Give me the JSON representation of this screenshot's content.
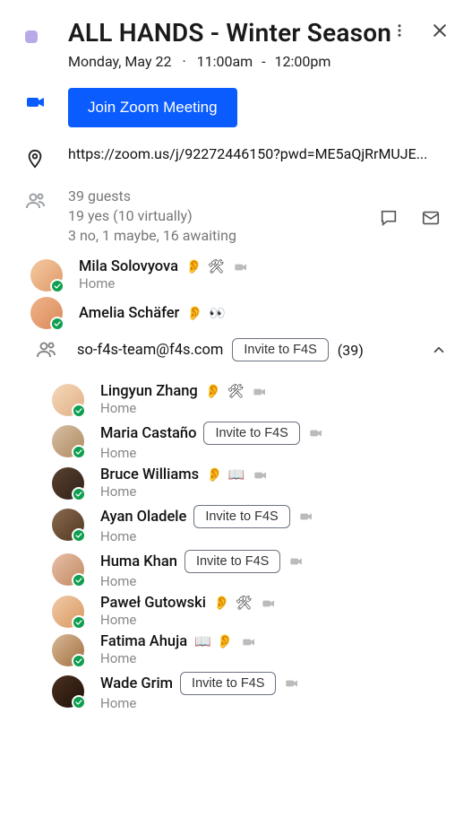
{
  "header": {
    "title": "ALL HANDS - Winter Season",
    "date": "Monday, May 22",
    "time_start": "11:00am",
    "time_end": "12:00pm",
    "color": "#b9a9e8"
  },
  "join": {
    "label": "Join Zoom Meeting",
    "link": "https://zoom.us/j/92272446150?pwd=ME5aQjRrMUJE..."
  },
  "guests": {
    "total_line": "39 guests",
    "yes_line": "19 yes (10 virtually)",
    "status_line": "3 no, 1 maybe, 16 awaiting"
  },
  "invite_label": "Invite to F4S",
  "attendees_top": [
    {
      "name": "Mila Solovyova",
      "sub": "Home",
      "badges": [
        "👂",
        "🛠"
      ],
      "video": true
    },
    {
      "name": "Amelia Schäfer",
      "sub": "",
      "badges": [
        "👂",
        "👀"
      ],
      "video": false
    }
  ],
  "group": {
    "email": "so-f4s-team@f4s.com",
    "count": "(39)",
    "invite": true
  },
  "attendees_sub": [
    {
      "name": "Lingyun Zhang",
      "sub": "Home",
      "badges": [
        "👂",
        "🛠"
      ],
      "video": true,
      "invite": false
    },
    {
      "name": "Maria Castaño",
      "sub": "Home",
      "badges": [],
      "video": true,
      "invite": true
    },
    {
      "name": "Bruce Williams",
      "sub": "Home",
      "badges": [
        "👂",
        "📖"
      ],
      "video": true,
      "invite": false
    },
    {
      "name": "Ayan Oladele",
      "sub": "Home",
      "badges": [],
      "video": true,
      "invite": true
    },
    {
      "name": "Huma Khan",
      "sub": "Home",
      "badges": [],
      "video": true,
      "invite": true
    },
    {
      "name": "Paweł Gutowski",
      "sub": "Home",
      "badges": [
        "👂",
        "🛠"
      ],
      "video": true,
      "invite": false
    },
    {
      "name": "Fatima Ahuja",
      "sub": "Home",
      "badges": [
        "📖",
        "👂"
      ],
      "video": true,
      "invite": false
    },
    {
      "name": "Wade Grim",
      "sub": "Home",
      "badges": [],
      "video": true,
      "invite": true
    }
  ]
}
